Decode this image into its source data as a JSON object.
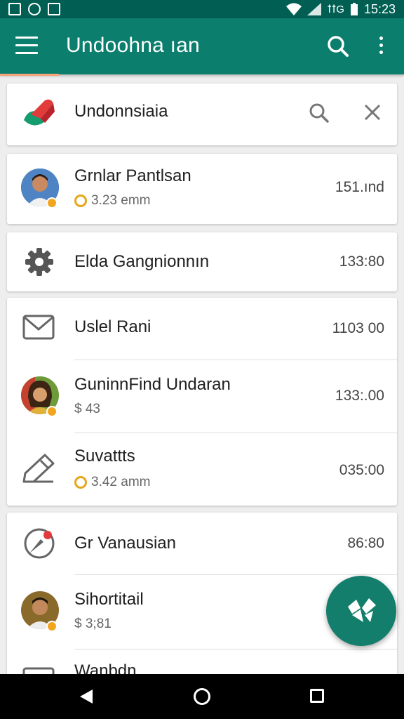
{
  "status_bar": {
    "time": "15:23",
    "carrier_glyph": "ꝉꝉG"
  },
  "app_bar": {
    "title": "Undoohna ıan"
  },
  "search_card": {
    "query": "Undonnsiaia"
  },
  "items": [
    {
      "name": "Grnlar Pantlsan",
      "subtitle": "3.23 emm",
      "time": "151.ınd"
    },
    {
      "name": "Elda Gangnionnın",
      "subtitle": "",
      "time": "133:80"
    },
    {
      "name": "Uslel Rani",
      "subtitle": "",
      "time": "1103 00"
    },
    {
      "name": "GuninnFind Undaran",
      "subtitle": "$ 43",
      "time": "133:.00"
    },
    {
      "name": "Suvattts",
      "subtitle": "3.42 amm",
      "time": "035:00"
    },
    {
      "name": "Gr Vanausian",
      "subtitle": "",
      "time": "86:80"
    },
    {
      "name": "Sihortitail",
      "subtitle": "$ 3;81",
      "time": ""
    },
    {
      "name": "Wanbdn",
      "subtitle": "",
      "time": ""
    }
  ],
  "icons": {
    "avatar_badge_color": "#f2a51f",
    "accent": "#0b7e6e",
    "fab_color": "#137e6c"
  }
}
